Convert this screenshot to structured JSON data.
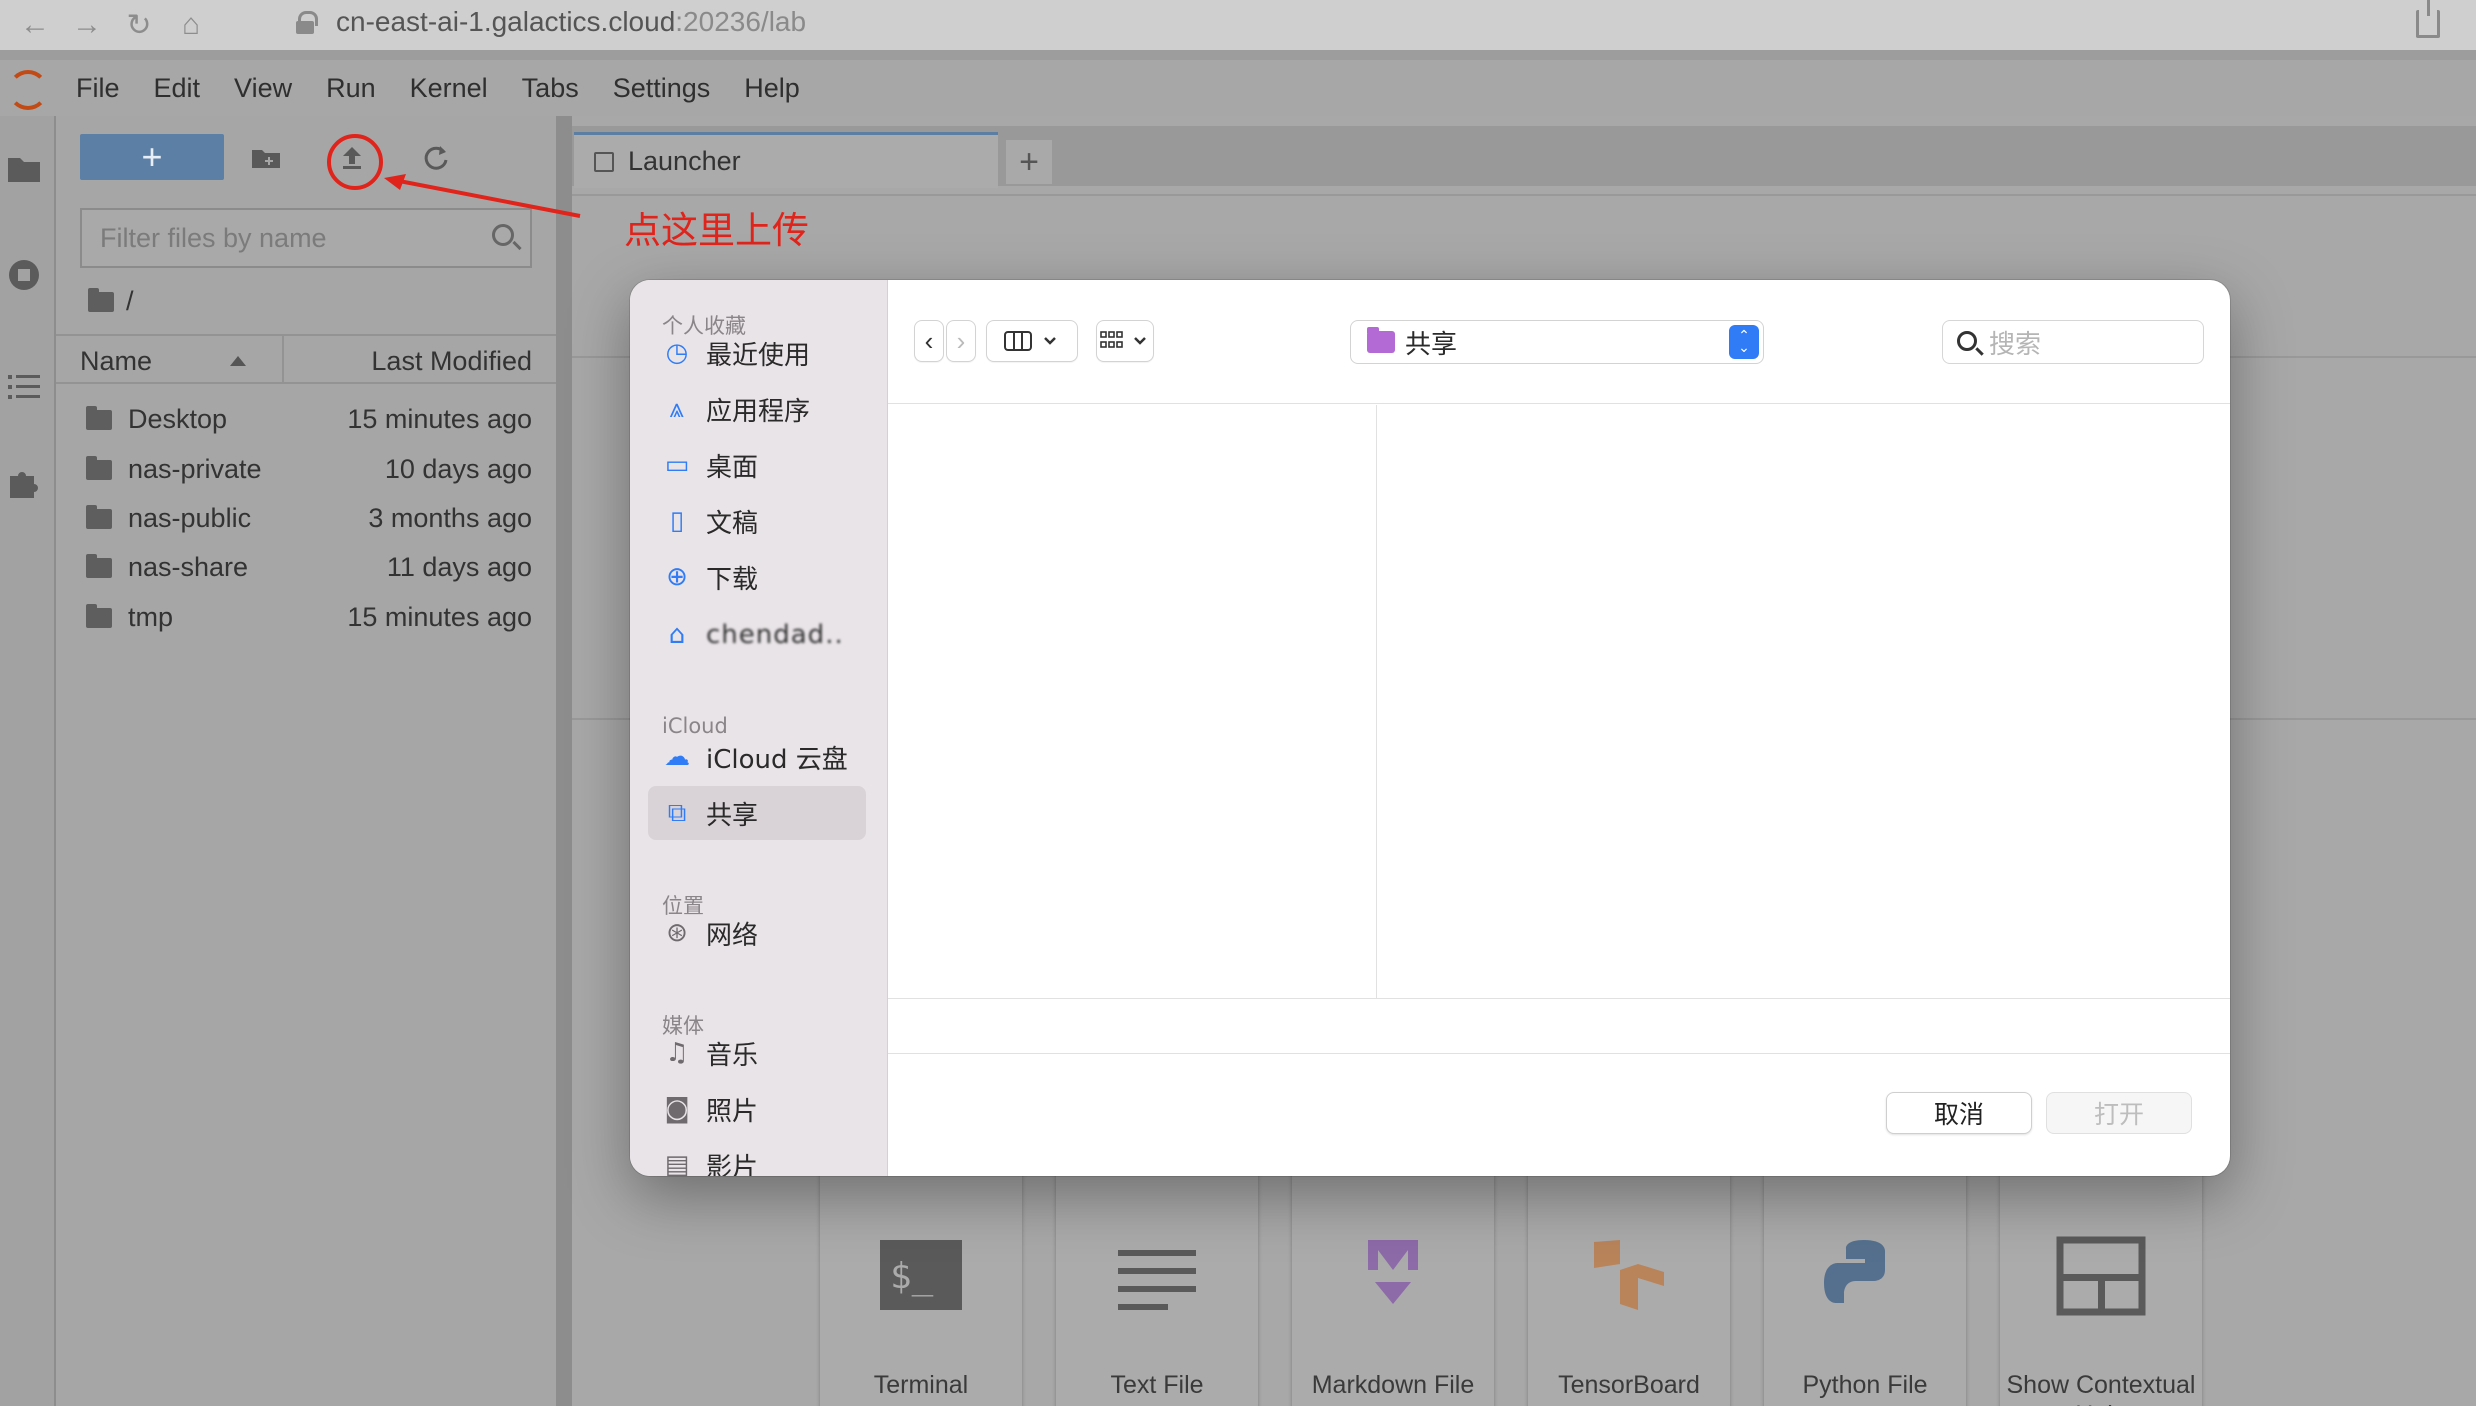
{
  "browser": {
    "url_host": "cn-east-ai-1.galactics.cloud",
    "url_rest": ":20236/lab"
  },
  "menubar": {
    "items": [
      "File",
      "Edit",
      "View",
      "Run",
      "Kernel",
      "Tabs",
      "Settings",
      "Help"
    ]
  },
  "filebrowser": {
    "new_label": "+",
    "filter_placeholder": "Filter files by name",
    "breadcrumb": "/",
    "col_name": "Name",
    "col_modified": "Last Modified",
    "rows": [
      {
        "name": "Desktop",
        "modified": "15 minutes ago"
      },
      {
        "name": "nas-private",
        "modified": "10 days ago"
      },
      {
        "name": "nas-public",
        "modified": "3 months ago"
      },
      {
        "name": "nas-share",
        "modified": "11 days ago"
      },
      {
        "name": "tmp",
        "modified": "15 minutes ago"
      }
    ]
  },
  "main": {
    "tab_label": "Launcher",
    "tab_add": "+",
    "launcher_cards": [
      "Terminal",
      "Text File",
      "Markdown File",
      "TensorBoard",
      "Python File",
      "Show Contextual Help"
    ]
  },
  "annotation": {
    "text": "点这里上传",
    "color": "#e0241b"
  },
  "dialog": {
    "sections": {
      "favorites": "个人收藏",
      "icloud": "iCloud",
      "locations": "位置",
      "media": "媒体"
    },
    "favorites": [
      "最近使用",
      "应用程序",
      "桌面",
      "文稿",
      "下载",
      "chendad.."
    ],
    "icloud_items": [
      "iCloud 云盘",
      "共享"
    ],
    "location_items": [
      "网络"
    ],
    "media_items": [
      "音乐",
      "照片",
      "影片"
    ],
    "selected_location": "共享",
    "search_placeholder": "搜索",
    "cancel_label": "取消",
    "open_label": "打开"
  }
}
